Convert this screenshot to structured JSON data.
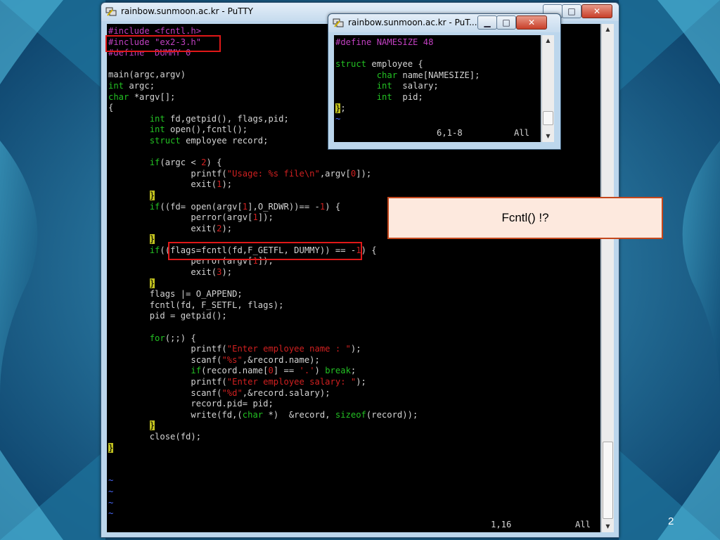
{
  "main_window": {
    "title": "rainbow.sunmoon.ac.kr - PuTTY",
    "minimize": "▁",
    "maximize": "□",
    "close": "✕",
    "status_pos": "1,16",
    "status_all": "All",
    "lines": [
      "#include <fcntl.h>",
      "#include \"ex2-3.h\"",
      "#define  DUMMY 0",
      "",
      "main(argc,argv)",
      "int argc;",
      "char *argv[];",
      "{",
      "        int fd,getpid(), flags,pid;",
      "        int open(),fcntl();",
      "        struct employee record;",
      "",
      "        if(argc < 2) {",
      "                printf(\"Usage: %s file\\n\",argv[0]);",
      "                exit(1);",
      "        }",
      "        if((fd= open(argv[1],O_RDWR))== -1) {",
      "                perror(argv[1]);",
      "                exit(2);",
      "        }",
      "        if((flags=fcntl(fd,F_GETFL, DUMMY)) == -1) {",
      "                perror(argv[1]);",
      "                exit(3);",
      "        }",
      "        flags |= O_APPEND;",
      "        fcntl(fd, F_SETFL, flags);",
      "        pid = getpid();",
      "",
      "        for(;;) {",
      "                printf(\"Enter employee name : \");",
      "                scanf(\"%s\",&record.name);",
      "                if(record.name[0] == '.') break;",
      "                printf(\"Enter employee salary: \");",
      "                scanf(\"%d\",&record.salary);",
      "                record.pid= pid;",
      "                write(fd,(char *)  &record, sizeof(record));",
      "        }",
      "        close(fd);",
      "}",
      "",
      "",
      "~",
      "~",
      "~",
      "~"
    ]
  },
  "small_window": {
    "title": "rainbow.sunmoon.ac.kr - PuT...",
    "minimize": "▁",
    "maximize": "□",
    "close": "✕",
    "status_pos": "6,1-8",
    "status_all": "All",
    "lines": [
      "#define NAMESIZE 48",
      "",
      "struct employee {",
      "        char name[NAMESIZE];",
      "        int  salary;",
      "        int  pid;",
      "};",
      "~"
    ]
  },
  "callout": {
    "text": "Fcntl() !?"
  },
  "slide_number": "2",
  "colors": {
    "keyword": "#23c023",
    "preprocessor": "#c040c0",
    "string": "#d02020",
    "highlight_box": "#e01818",
    "callout_fill": "#fde9de",
    "callout_border": "#c4471c"
  }
}
